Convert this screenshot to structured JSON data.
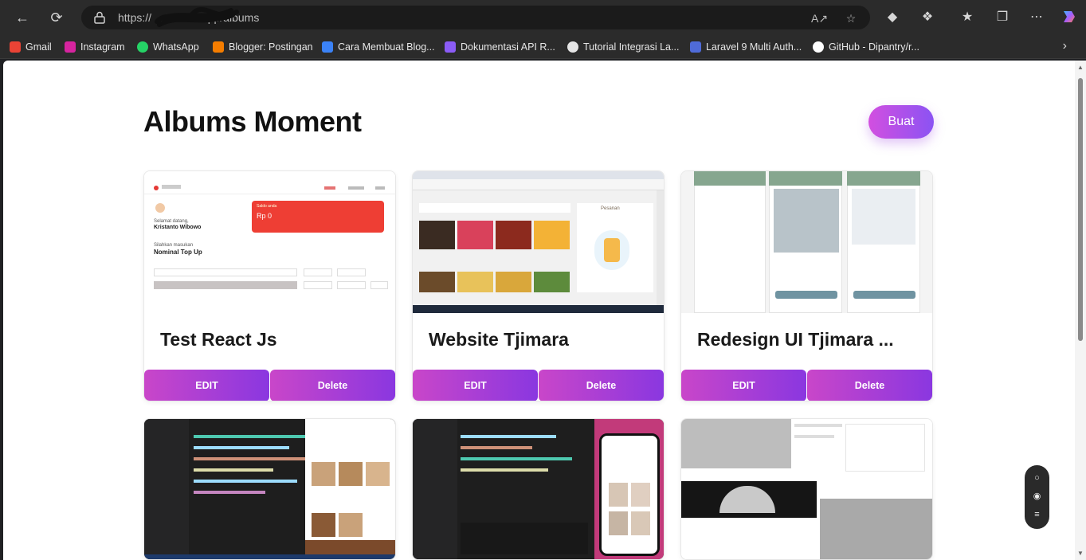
{
  "browser": {
    "url_prefix": "https://",
    "url_host": "...vercel.app",
    "url_path": "/albums"
  },
  "bookmarks": [
    {
      "label": "Gmail",
      "color": "#ea4335"
    },
    {
      "label": "Instagram",
      "color": "#d6249f"
    },
    {
      "label": "WhatsApp",
      "color": "#25d366"
    },
    {
      "label": "Blogger: Postingan",
      "color": "#f57d00"
    },
    {
      "label": "Cara Membuat Blog...",
      "color": "#3b82f6"
    },
    {
      "label": "Dokumentasi API R...",
      "color": "#8b5cf6"
    },
    {
      "label": "Tutorial Integrasi La...",
      "color": "#e5e5e5"
    },
    {
      "label": "Laravel 9 Multi Auth...",
      "color": "#4f6bd8"
    },
    {
      "label": "GitHub - Dipantry/r...",
      "color": "#ffffff"
    }
  ],
  "page": {
    "title": "Albums Moment",
    "create_label": "Buat"
  },
  "albums": [
    {
      "title": "Test React Js",
      "edit_label": "EDIT",
      "delete_label": "Delete"
    },
    {
      "title": "Website Tjimara",
      "edit_label": "EDIT",
      "delete_label": "Delete"
    },
    {
      "title": "Redesign UI Tjimara ...",
      "edit_label": "EDIT",
      "delete_label": "Delete"
    },
    {
      "title": "",
      "edit_label": "EDIT",
      "delete_label": "Delete"
    },
    {
      "title": "",
      "edit_label": "EDIT",
      "delete_label": "Delete"
    },
    {
      "title": "",
      "edit_label": "EDIT",
      "delete_label": "Delete"
    }
  ],
  "thumb_text": {
    "card1_balance_label": "Saldo anda",
    "card1_balance": "Rp 0",
    "card1_greeting": "Selamat datang,",
    "card1_name": "Kristanto Wibowo",
    "card1_prompt": "Silahkan masukan",
    "card1_heading": "Nominal Top Up",
    "card2_order": "Pesanan"
  },
  "colors": {
    "accent_start": "#c946c9",
    "accent_end": "#8a37e0"
  }
}
